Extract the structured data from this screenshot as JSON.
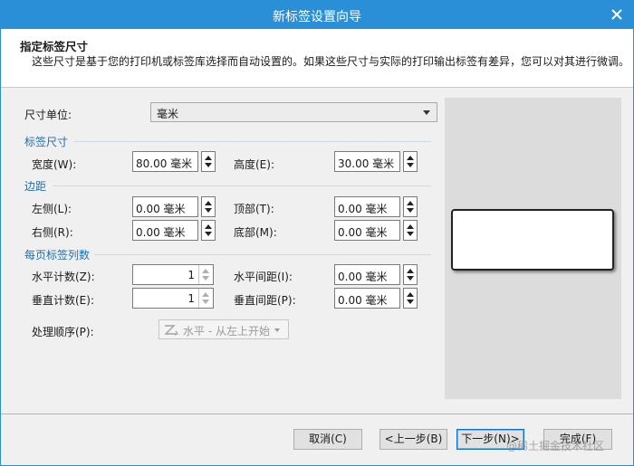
{
  "window": {
    "title": "新标签设置向导",
    "close_icon": "close-icon"
  },
  "header": {
    "title": "指定标签尺寸",
    "description": "这些尺寸是基于您的打印机或标签库选择而自动设置的。如果这些尺寸与实际的打印输出标签有差异，您可以对其进行微调。"
  },
  "unit": {
    "label": "尺寸单位:",
    "value": "毫米"
  },
  "sections": {
    "size": "标签尺寸",
    "margins": "边距",
    "per_page": "每页标签列数"
  },
  "fields": {
    "width": {
      "label": "宽度(W):",
      "value": "80.00 毫米"
    },
    "height": {
      "label": "高度(E):",
      "value": "30.00 毫米"
    },
    "left": {
      "label": "左侧(L):",
      "value": "0.00 毫米"
    },
    "top": {
      "label": "顶部(T):",
      "value": "0.00 毫米"
    },
    "right": {
      "label": "右侧(R):",
      "value": "0.00 毫米"
    },
    "bottom": {
      "label": "底部(M):",
      "value": "0.00 毫米"
    },
    "h_count": {
      "label": "水平计数(Z):",
      "value": "1"
    },
    "h_gap": {
      "label": "水平间距(I):",
      "value": "0.00 毫米"
    },
    "v_count": {
      "label": "垂直计数(E):",
      "value": "1"
    },
    "v_gap": {
      "label": "垂直间距(P):",
      "value": "0.00 毫米"
    }
  },
  "order": {
    "label": "处理顺序(P):",
    "value": "水平 - 从左上开始"
  },
  "buttons": {
    "cancel": "取消(C)",
    "back": "<上一步(B)",
    "next": "下一步(N)>",
    "finish": "完成(F)"
  },
  "watermark": "@稀土掘金技术社区",
  "colors": {
    "titlebar": "#2b8fd8",
    "section_text": "#1f6fb2",
    "preview_bg": "#dcdcdc"
  }
}
